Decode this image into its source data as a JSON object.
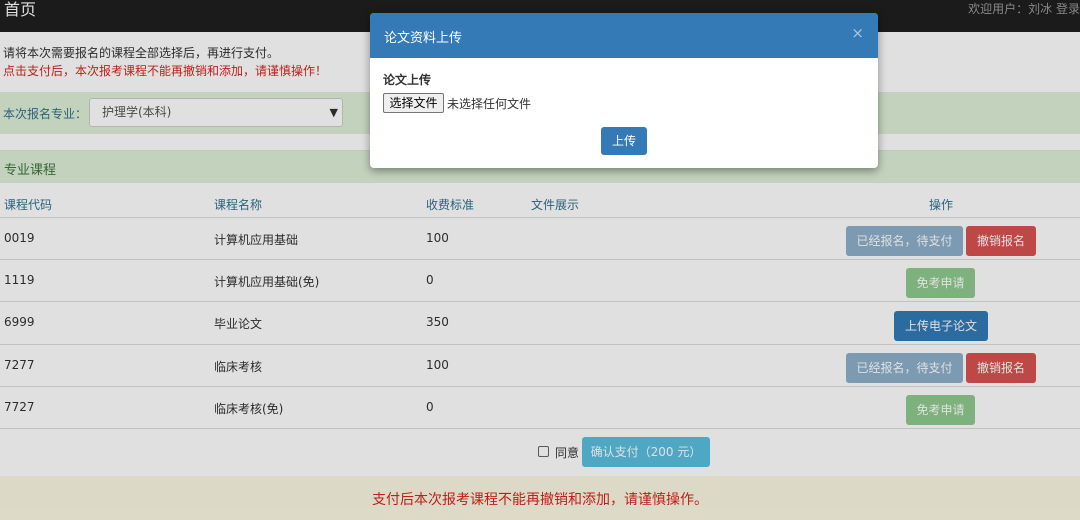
{
  "navbar": {
    "brand": "首页",
    "welcome": "欢迎用户：刘冰 登录"
  },
  "notes": {
    "line1": "请将本次需要报名的课程全部选择后，再进行支付。",
    "line2": "点击支付后，本次报考课程不能再撤销和添加，请谨慎操作！"
  },
  "major": {
    "label": "本次报名专业：",
    "selected": "护理学(本科)"
  },
  "section": {
    "title": "专业课程"
  },
  "table": {
    "headers": {
      "code": "课程代码",
      "name": "课程名称",
      "fee": "收费标准",
      "file": "文件展示",
      "action": "操作"
    },
    "rows": [
      {
        "code": "0019",
        "name": "计算机应用基础",
        "fee": "100"
      },
      {
        "code": "1119",
        "name": "计算机应用基础(免)",
        "fee": "0"
      },
      {
        "code": "6999",
        "name": "毕业论文",
        "fee": "350"
      },
      {
        "code": "7277",
        "name": "临床考核",
        "fee": "100"
      },
      {
        "code": "7727",
        "name": "临床考核(免)",
        "fee": "0"
      }
    ],
    "actions": {
      "registered": "已经报名，待支付",
      "cancel": "撤销报名",
      "exempt": "免考申请",
      "upload_thesis": "上传电子论文"
    }
  },
  "payment": {
    "agree_label": "同意",
    "confirm_label": "确认支付（200 元）"
  },
  "warning": {
    "text": "支付后本次报考课程不能再撤销和添加，请谨慎操作。"
  },
  "modal": {
    "title": "论文资料上传",
    "close": "×",
    "field_label": "论文上传",
    "choose_file": "选择文件",
    "no_file": "未选择任何文件",
    "upload": "上传"
  },
  "colors": {
    "primary": "#337ab7",
    "danger": "#d9534f",
    "success_light": "#dff0d8",
    "warning_bg": "#fcf8e3",
    "alert_text": "#d9241c"
  }
}
